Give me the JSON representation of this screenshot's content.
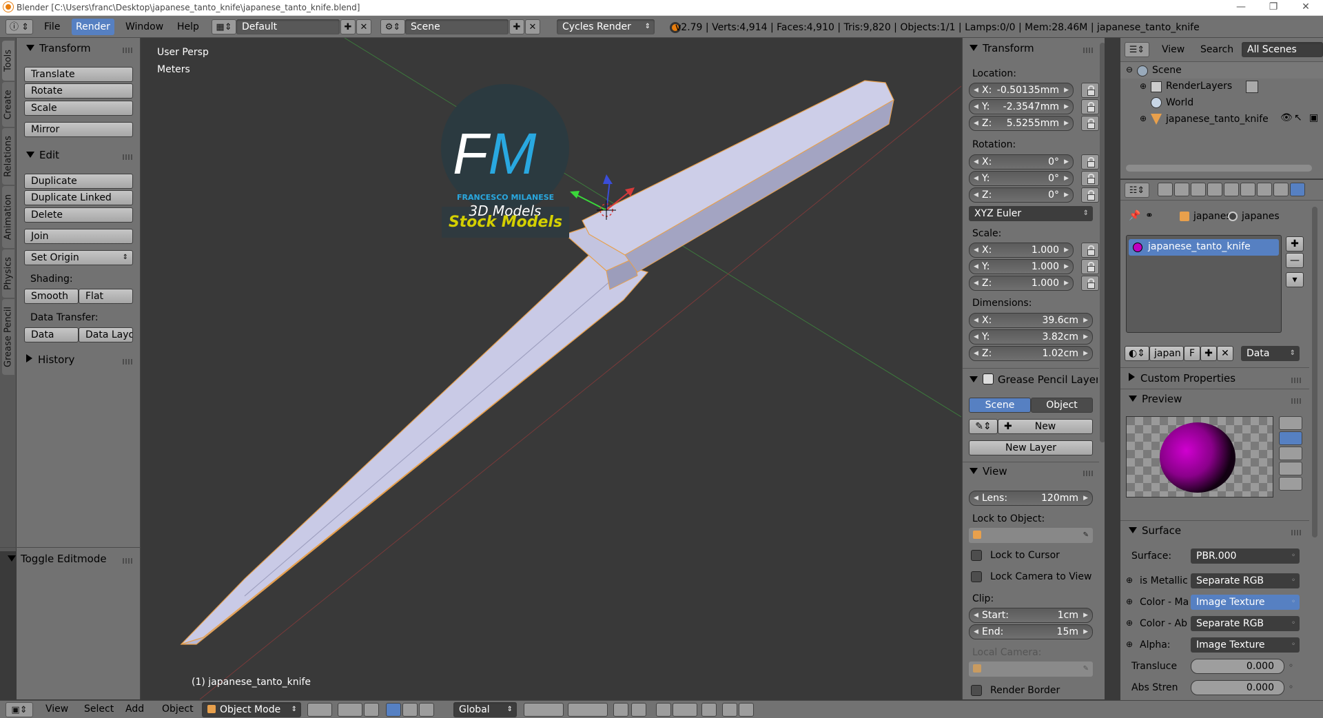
{
  "window": {
    "title": "Blender [C:\\Users\\franc\\Desktop\\japanese_tanto_knife\\japanese_tanto_knife.blend]",
    "controls": [
      "—",
      "❐",
      "✕"
    ]
  },
  "topbar": {
    "menus": [
      "File",
      "Render",
      "Window",
      "Help"
    ],
    "active_menu": "Render",
    "screen_layout": "Default",
    "scene": "Scene",
    "render_engine": "Cycles Render",
    "stats": "v2.79 | Verts:4,914 | Faces:4,910 | Tris:9,820 | Objects:1/1 | Lamps:0/0 | Mem:28.46M | japanese_tanto_knife"
  },
  "tabs": [
    "Tools",
    "Create",
    "Relations",
    "Animation",
    "Physics",
    "Grease Pencil"
  ],
  "toolshelf": {
    "transform_title": "Transform",
    "translate": "Translate",
    "rotate": "Rotate",
    "scale": "Scale",
    "mirror": "Mirror",
    "edit_title": "Edit",
    "duplicate": "Duplicate",
    "duplicate_linked": "Duplicate Linked",
    "delete": "Delete",
    "join": "Join",
    "set_origin": "Set Origin",
    "shading_label": "Shading:",
    "smooth": "Smooth",
    "flat": "Flat",
    "data_transfer_label": "Data Transfer:",
    "data": "Data",
    "data_layout": "Data Layo",
    "history": "History",
    "toggle_editmode": "Toggle Editmode"
  },
  "viewport": {
    "view_name": "User Persp",
    "units": "Meters",
    "object_label": "(1) japanese_tanto_knife",
    "watermark": {
      "initials_f": "F",
      "initials_m": "M",
      "brand": "FRANCESCO MILANESE",
      "sub": "3D Models",
      "badge": "Stock Models"
    },
    "colors": {
      "blade": "#c7c8e4",
      "outline": "#e8a04c",
      "background": "#393939"
    }
  },
  "npanel": {
    "transform_title": "Transform",
    "location_label": "Location:",
    "location": [
      {
        "axis": "X:",
        "value": "-0.50135mm"
      },
      {
        "axis": "Y:",
        "value": "-2.3547mm"
      },
      {
        "axis": "Z:",
        "value": "5.5255mm"
      }
    ],
    "rotation_label": "Rotation:",
    "rotation": [
      {
        "axis": "X:",
        "value": "0°"
      },
      {
        "axis": "Y:",
        "value": "0°"
      },
      {
        "axis": "Z:",
        "value": "0°"
      }
    ],
    "rotation_mode": "XYZ Euler",
    "scale_label": "Scale:",
    "scale": [
      {
        "axis": "X:",
        "value": "1.000"
      },
      {
        "axis": "Y:",
        "value": "1.000"
      },
      {
        "axis": "Z:",
        "value": "1.000"
      }
    ],
    "dimensions_label": "Dimensions:",
    "dimensions": [
      {
        "axis": "X:",
        "value": "39.6cm"
      },
      {
        "axis": "Y:",
        "value": "3.82cm"
      },
      {
        "axis": "Z:",
        "value": "1.02cm"
      }
    ],
    "gp_title": "Grease Pencil Layer",
    "gp_scene": "Scene",
    "gp_object": "Object",
    "gp_new": "New",
    "gp_new_layer": "New Layer",
    "view_title": "View",
    "lens": {
      "label": "Lens:",
      "value": "120mm"
    },
    "lock_object_label": "Lock to Object:",
    "lock_cursor": "Lock to Cursor",
    "lock_camera": "Lock Camera to View",
    "clip_label": "Clip:",
    "clip_start": {
      "label": "Start:",
      "value": "1cm"
    },
    "clip_end": {
      "label": "End:",
      "value": "15m"
    },
    "local_camera_label": "Local Camera:",
    "render_border": "Render Border"
  },
  "outliner": {
    "view_menu": "View",
    "search_menu": "Search",
    "filter": "All Scenes",
    "items": [
      {
        "label": "Scene"
      },
      {
        "label": "RenderLayers"
      },
      {
        "label": "World"
      },
      {
        "label": "japanese_tanto_knife"
      }
    ]
  },
  "properties": {
    "breadcrumb_obj": "japanes",
    "breadcrumb_mat": "japanes",
    "material_slot": "japanese_tanto_knife",
    "mat_name_short": "japan",
    "fake_user": "F",
    "link": "Data",
    "custom_props": "Custom Properties",
    "preview": "Preview",
    "surface_title": "Surface",
    "surface_label": "Surface:",
    "surface_value": "PBR.000",
    "inputs": [
      {
        "label": "is Metallic",
        "value": "Separate RGB"
      },
      {
        "label": "Color - Ma",
        "value": "Image Texture"
      },
      {
        "label": "Color - Ab",
        "value": "Separate RGB"
      },
      {
        "label": "Alpha:",
        "value": "Image Texture"
      }
    ],
    "translucency": {
      "label": "Transluce",
      "value": "0.000"
    },
    "abs_strength": {
      "label": "Abs Stren",
      "value": "0.000"
    }
  },
  "bottombar": {
    "menus": [
      "View",
      "Select",
      "Add",
      "Object"
    ],
    "mode": "Object Mode",
    "orientation": "Global"
  }
}
